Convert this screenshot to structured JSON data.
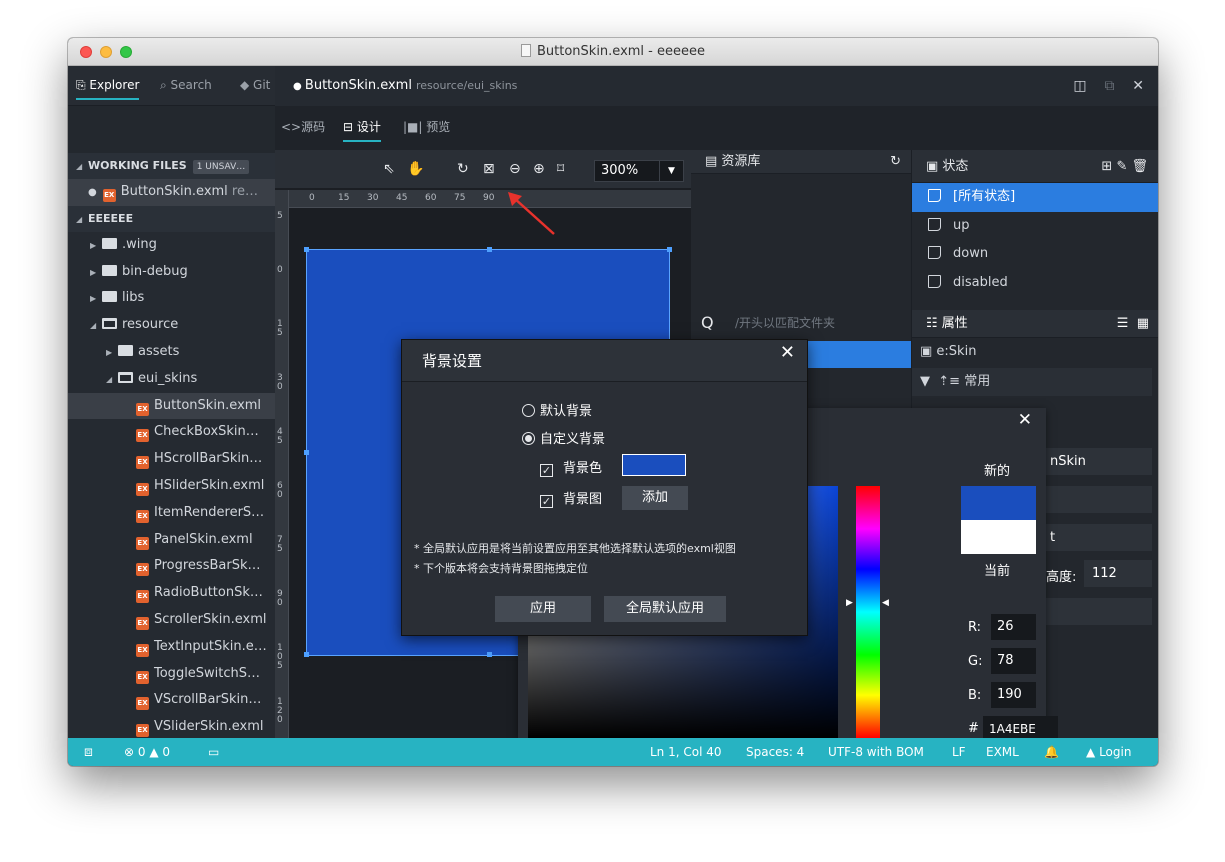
{
  "window": {
    "title": "ButtonSkin.exml - eeeeee"
  },
  "sidebar": {
    "tabs": [
      {
        "label": "Explorer"
      },
      {
        "label": "Search"
      },
      {
        "label": "Git"
      }
    ],
    "working_files": {
      "label": "WORKING FILES",
      "badge": "1 UNSAV…",
      "file": "ButtonSkin.exml",
      "file_path": "re…"
    },
    "project": {
      "label": "EEEEEE"
    },
    "tree": [
      {
        "label": ".wing",
        "type": "folder",
        "depth": 1,
        "expanded": false
      },
      {
        "label": "bin-debug",
        "type": "folder",
        "depth": 1,
        "expanded": false
      },
      {
        "label": "libs",
        "type": "folder",
        "depth": 1,
        "expanded": false
      },
      {
        "label": "resource",
        "type": "folder",
        "depth": 1,
        "expanded": true
      },
      {
        "label": "assets",
        "type": "folder",
        "depth": 2,
        "expanded": false
      },
      {
        "label": "eui_skins",
        "type": "folder",
        "depth": 2,
        "expanded": true
      },
      {
        "label": "ButtonSkin.exml",
        "type": "file",
        "depth": 3,
        "selected": true
      },
      {
        "label": "CheckBoxSkin…",
        "type": "file",
        "depth": 3
      },
      {
        "label": "HScrollBarSkin…",
        "type": "file",
        "depth": 3
      },
      {
        "label": "HSliderSkin.exml",
        "type": "file",
        "depth": 3
      },
      {
        "label": "ItemRendererS…",
        "type": "file",
        "depth": 3
      },
      {
        "label": "PanelSkin.exml",
        "type": "file",
        "depth": 3
      },
      {
        "label": "ProgressBarSk…",
        "type": "file",
        "depth": 3
      },
      {
        "label": "RadioButtonSk…",
        "type": "file",
        "depth": 3
      },
      {
        "label": "ScrollerSkin.exml",
        "type": "file",
        "depth": 3
      },
      {
        "label": "TextInputSkin.e…",
        "type": "file",
        "depth": 3
      },
      {
        "label": "ToggleSwitchS…",
        "type": "file",
        "depth": 3
      },
      {
        "label": "VScrollBarSkin…",
        "type": "file",
        "depth": 3
      },
      {
        "label": "VSliderSkin.exml",
        "type": "file",
        "depth": 3
      }
    ]
  },
  "editor": {
    "tab": {
      "label": "ButtonSkin.exml",
      "path": "resource/eui_skins"
    },
    "modes": [
      {
        "label": "源码"
      },
      {
        "label": "设计"
      },
      {
        "label": "预览"
      }
    ],
    "zoom": "300%",
    "ruler_h": [
      "0",
      "15",
      "30",
      "45",
      "60",
      "75",
      "90"
    ],
    "ruler_v": [
      "5",
      "0",
      "15",
      "30",
      "45",
      "60",
      "75",
      "90",
      "105",
      "120"
    ],
    "skin_color": "#1a4ebe"
  },
  "resource_panel": {
    "title": "资源库",
    "search_placeholder": "/开头以匹配文件夹"
  },
  "state_panel": {
    "title": "状态",
    "states": [
      {
        "label": "[所有状态]",
        "selected": true
      },
      {
        "label": "up"
      },
      {
        "label": "down"
      },
      {
        "label": "disabled"
      }
    ]
  },
  "property_panel": {
    "title": "属性",
    "target": "e:Skin",
    "group": "常用",
    "class_field": "nSkin",
    "field3_partial": "t",
    "height_label": "高度:",
    "height_value": "112"
  },
  "color_picker": {
    "new_label": "新的",
    "current_label": "当前",
    "new_color": "#1a4ebe",
    "current_color": "#ffffff",
    "r_label": "R:",
    "r": "26",
    "g_label": "G:",
    "g": "78",
    "b_label": "B:",
    "b": "190",
    "hex_label": "#",
    "hex": "1A4EBE"
  },
  "dialog": {
    "title": "背景设置",
    "option_default": "默认背景",
    "option_custom": "自定义背景",
    "bg_color_label": "背景色",
    "bg_color": "#1a4ebe",
    "bg_image_label": "背景图",
    "add_button": "添加",
    "note1": "* 全局默认应用是将当前设置应用至其他选择默认选项的exml视图",
    "note2": "* 下个版本将会支持背景图拖拽定位",
    "apply_button": "应用",
    "global_apply_button": "全局默认应用"
  },
  "status_bar": {
    "errors": "0",
    "warnings": "0",
    "position": "Ln 1, Col 40",
    "spaces": "Spaces: 4",
    "encoding": "UTF-8 with BOM",
    "eol": "LF",
    "language": "EXML",
    "login": "Login"
  }
}
